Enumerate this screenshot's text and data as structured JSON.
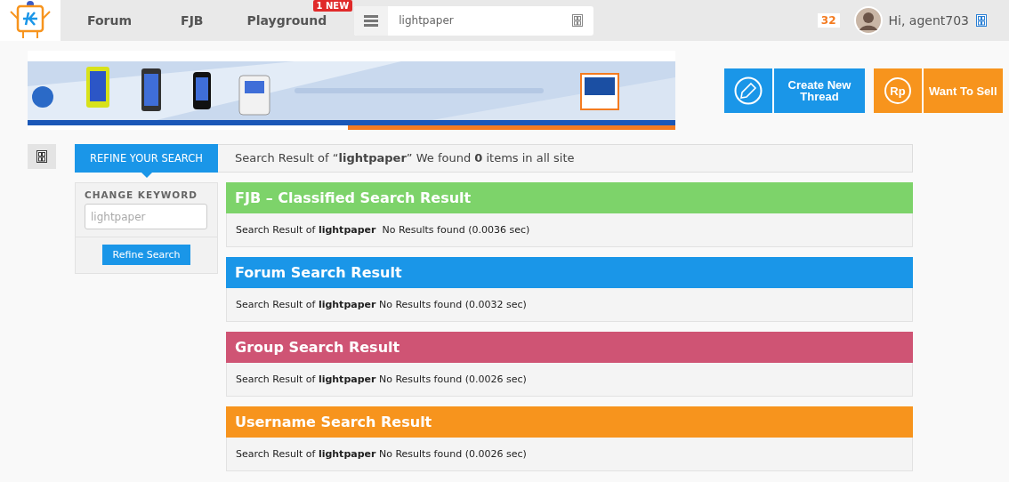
{
  "header": {
    "nav": [
      {
        "label": "Forum"
      },
      {
        "label": "FJB"
      },
      {
        "label": "Playground",
        "badge": "1 NEW"
      }
    ],
    "search": {
      "value": "lightpaper"
    },
    "notifications": "32",
    "greeting": "Hi, agent703"
  },
  "actions": [
    {
      "label": "Create New Thread",
      "kind": "pencil",
      "color": "#1a96e8"
    },
    {
      "label": "Want To Sell",
      "kind": "currency",
      "symbol": "Rp",
      "color": "#f7941d"
    }
  ],
  "refine": {
    "tab": "REFINE YOUR SEARCH",
    "summary": "Search Result of “**lightpaper**” We found **0** items in all site",
    "keyword_label": "CHANGE KEYWORD",
    "keyword": {
      "placeholder": "lightpaper"
    },
    "button": "Refine Search"
  },
  "results": [
    {
      "title": "FJB – Classified Search Result",
      "color": "#7dd36a",
      "message": "Search Result of **lightpaper**  No Results found (0.0036 sec)"
    },
    {
      "title": "Forum Search Result",
      "color": "#1a96e8",
      "message": "Search Result of **lightpaper** No Results found (0.0032 sec)"
    },
    {
      "title": "Group Search Result",
      "color": "#cf5474",
      "message": "Search Result of **lightpaper** No Results found (0.0026 sec)"
    },
    {
      "title": "Username Search Result",
      "color": "#f7941d",
      "message": "Search Result of **lightpaper** No Results found (0.0026 sec)"
    }
  ]
}
